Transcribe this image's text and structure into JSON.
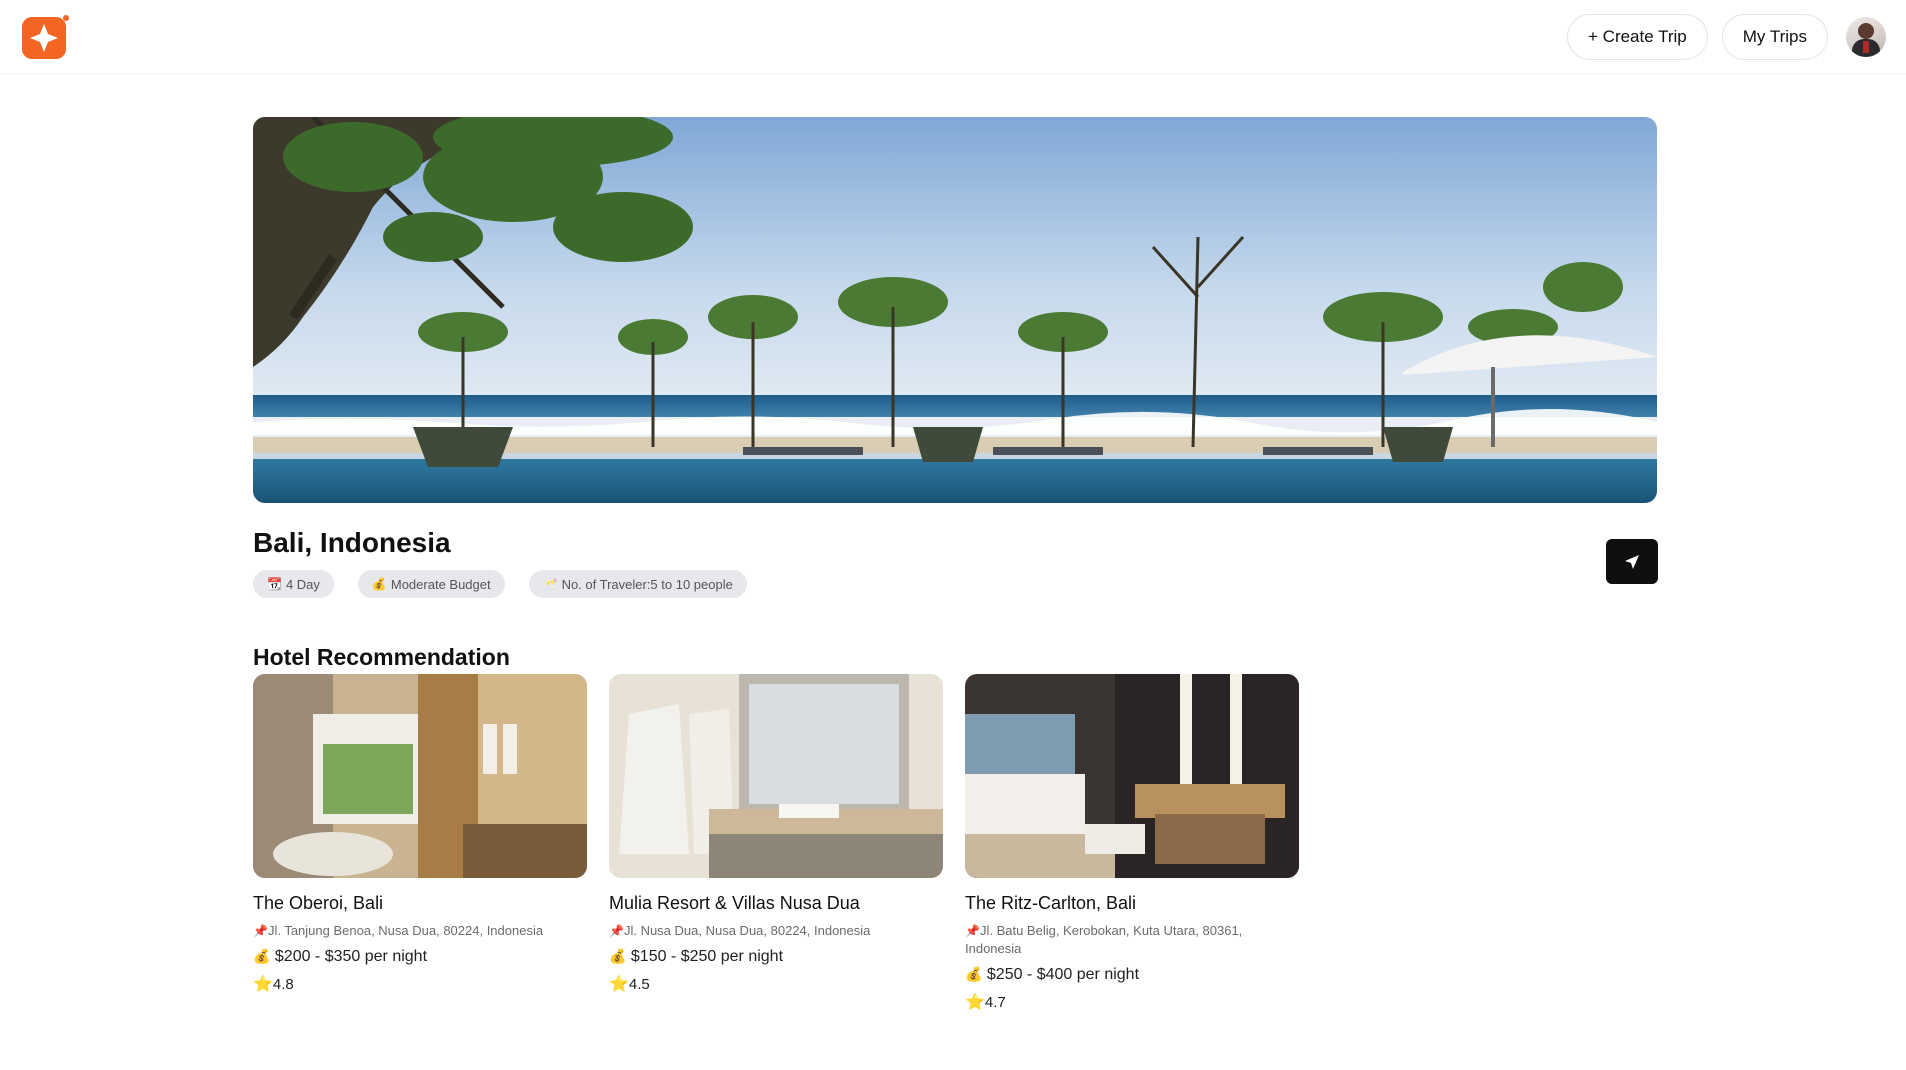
{
  "header": {
    "create_trip_label": "+ Create Trip",
    "my_trips_label": "My Trips",
    "brand_color": "#f26522"
  },
  "destination": {
    "title": "Bali, Indonesia",
    "chips": {
      "days": "4 Day",
      "budget": "Moderate Budget",
      "travelers": "No. of Traveler:5 to 10 people"
    },
    "chip_icons": {
      "days": "📆",
      "budget": "💰",
      "travelers": "🥂"
    }
  },
  "hotels_section": {
    "title": "Hotel Recommendation",
    "items": [
      {
        "name": "The Oberoi, Bali",
        "address": "Jl. Tanjung Benoa, Nusa Dua, 80224, Indonesia",
        "price": "$200 - $350 per night",
        "rating": "4.8"
      },
      {
        "name": "Mulia Resort & Villas Nusa Dua",
        "address": "Jl. Nusa Dua, Nusa Dua, 80224, Indonesia",
        "price": "$150 - $250 per night",
        "rating": "4.5"
      },
      {
        "name": "The Ritz-Carlton, Bali",
        "address": "Jl. Batu Belig, Kerobokan, Kuta Utara, 80361, Indonesia",
        "price": "$250 - $400 per night",
        "rating": "4.7"
      }
    ]
  },
  "icons": {
    "pin": "📌",
    "money_bag": "💰",
    "star": "⭐"
  }
}
